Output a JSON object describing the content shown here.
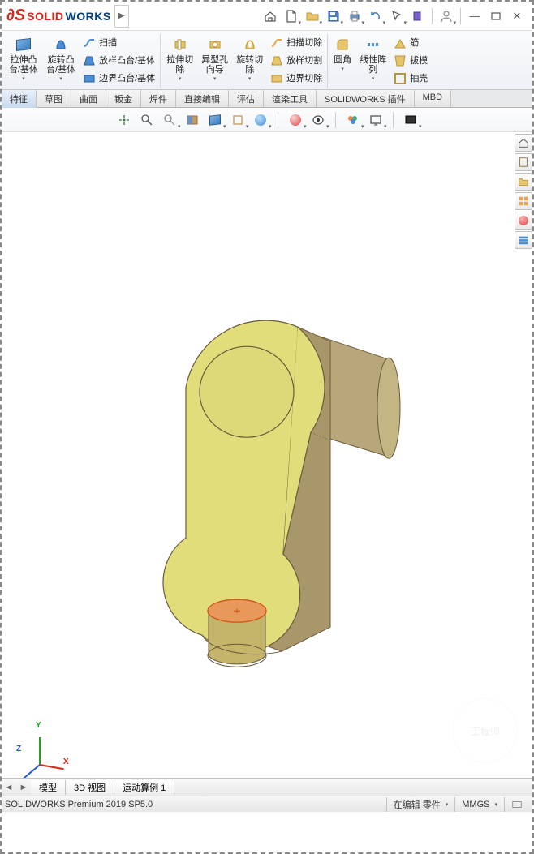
{
  "app": {
    "name_solid": "SOLID",
    "name_works": "WORKS"
  },
  "ribbon": {
    "extrude": "拉伸凸\n台/基体",
    "revolve": "旋转凸\n台/基体",
    "sweep": "扫描",
    "loft": "放样凸台/基体",
    "boundary": "边界凸台/基体",
    "cut_extrude": "拉伸切\n除",
    "hole_wizard": "异型孔\n向导",
    "cut_revolve": "旋转切\n除",
    "cut_sweep": "扫描切除",
    "cut_loft": "放样切割",
    "cut_boundary": "边界切除",
    "fillet": "圆角",
    "pattern": "线性阵\n列",
    "rib": "筋",
    "draft": "拔模",
    "shell": "抽壳"
  },
  "tabs": [
    "特征",
    "草图",
    "曲面",
    "钣金",
    "焊件",
    "直接编辑",
    "评估",
    "渲染工具",
    "SOLIDWORKS 插件",
    "MBD"
  ],
  "bottom_tabs": [
    "模型",
    "3D 视图",
    "运动算例 1"
  ],
  "status": {
    "version": "SOLIDWORKS Premium 2019 SP5.0",
    "state": "在编辑 零件",
    "units": "MMGS"
  }
}
